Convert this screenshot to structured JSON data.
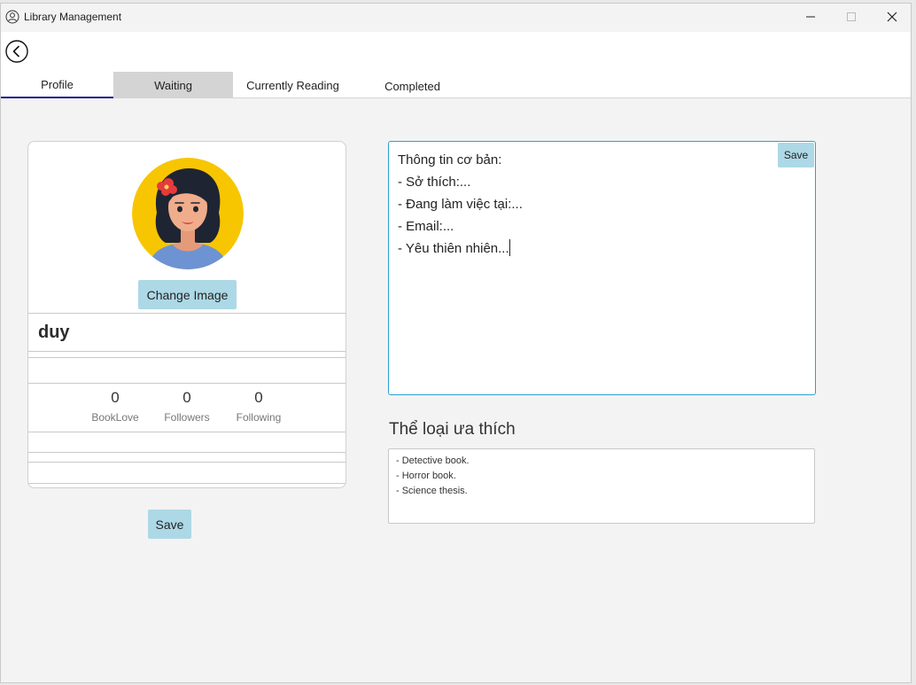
{
  "window": {
    "title": "Library Management"
  },
  "tabs": [
    {
      "label": "Profile",
      "active": true
    },
    {
      "label": "Waiting",
      "active": false
    },
    {
      "label": "Currently Reading",
      "active": false
    },
    {
      "label": "Completed",
      "active": false
    }
  ],
  "profile": {
    "change_image_label": "Change Image",
    "name": "duy",
    "stats": [
      {
        "value": "0",
        "label": "BookLove"
      },
      {
        "value": "0",
        "label": "Followers"
      },
      {
        "value": "0",
        "label": "Following"
      }
    ],
    "save_label": "Save"
  },
  "bio": {
    "save_label": "Save",
    "lines": [
      "Thông tin cơ bản:",
      "- Sở thích:...",
      "- Đang làm việc tại:...",
      "- Email:...",
      "- Yêu thiên nhiên..."
    ]
  },
  "genres": {
    "title": "Thể loại ưa thích",
    "lines": [
      "- Detective book.",
      "- Horror book.",
      "- Science thesis."
    ]
  },
  "colors": {
    "button_bg": "#add8e6",
    "active_tab_underline": "#1d1d8f",
    "focus_border": "#2aa3cf",
    "hover_tab_bg": "#d4d4d4",
    "avatar_bg": "#f7c600"
  },
  "icons": {
    "app": "user-circle-icon",
    "back": "back-arrow-icon",
    "minimize": "minimize-icon",
    "maximize": "maximize-icon",
    "close": "close-icon"
  }
}
